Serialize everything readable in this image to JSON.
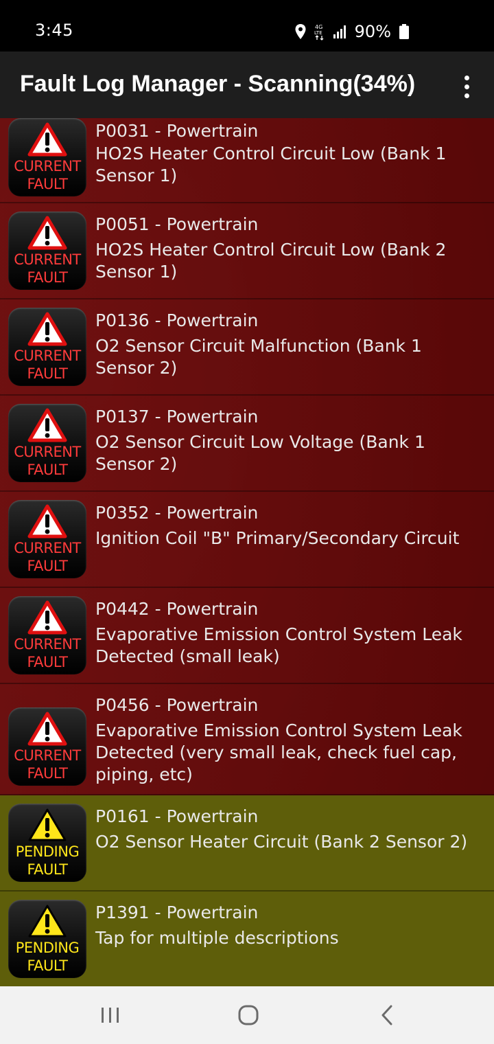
{
  "status": {
    "time": "3:45",
    "battery": "90%",
    "icons": [
      "location-icon",
      "4g-lte-icon",
      "signal-icon",
      "battery-icon"
    ]
  },
  "app_bar": {
    "title": "Fault Log Manager - Scanning(34%)",
    "menu_icon": "overflow-menu-icon"
  },
  "faults": [
    {
      "type": "current",
      "badge_line1": "CURRENT",
      "badge_line2": "FAULT",
      "code": "P0031 - Powertrain",
      "description": "HO2S Heater Control Circuit Low (Bank 1 Sensor 1)"
    },
    {
      "type": "current",
      "badge_line1": "CURRENT",
      "badge_line2": "FAULT",
      "code": "P0051 - Powertrain",
      "description": "HO2S Heater Control Circuit Low (Bank 2 Sensor 1)"
    },
    {
      "type": "current",
      "badge_line1": "CURRENT",
      "badge_line2": "FAULT",
      "code": "P0136 - Powertrain",
      "description": "O2 Sensor Circuit Malfunction (Bank 1 Sensor 2)"
    },
    {
      "type": "current",
      "badge_line1": "CURRENT",
      "badge_line2": "FAULT",
      "code": "P0137 - Powertrain",
      "description": "O2 Sensor Circuit Low Voltage (Bank 1 Sensor 2)"
    },
    {
      "type": "current",
      "badge_line1": "CURRENT",
      "badge_line2": "FAULT",
      "code": "P0352 - Powertrain",
      "description": "Ignition Coil \"B\" Primary/Secondary Circuit"
    },
    {
      "type": "current",
      "badge_line1": "CURRENT",
      "badge_line2": "FAULT",
      "code": "P0442 - Powertrain",
      "description": "Evaporative Emission Control System Leak Detected (small leak)"
    },
    {
      "type": "current",
      "badge_line1": "CURRENT",
      "badge_line2": "FAULT",
      "code": "P0456 - Powertrain",
      "description": "Evaporative Emission Control System Leak Detected (very small leak, check fuel cap, piping, etc)"
    },
    {
      "type": "pending",
      "badge_line1": "PENDING",
      "badge_line2": "FAULT",
      "code": "P0161 - Powertrain",
      "description": "O2 Sensor Heater Circuit (Bank 2 Sensor 2)"
    },
    {
      "type": "pending",
      "badge_line1": "PENDING",
      "badge_line2": "FAULT",
      "code": "P1391 - Powertrain",
      "description": "Tap for multiple descriptions"
    }
  ],
  "colors": {
    "current_bg": "#6e1010",
    "pending_bg": "#5e5e0a",
    "current_label": "#ff3b3b",
    "pending_label": "#ffe61a"
  },
  "nav": {
    "icons": [
      "recent-apps-icon",
      "home-icon",
      "back-icon"
    ]
  }
}
